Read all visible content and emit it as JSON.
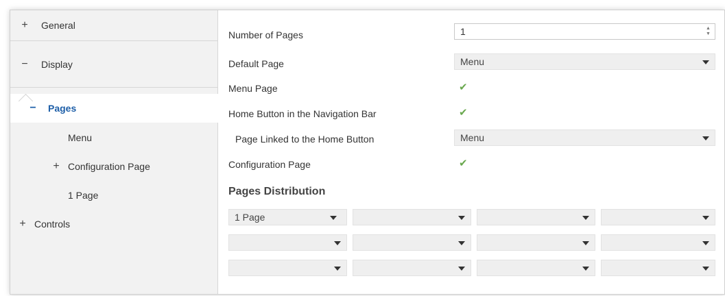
{
  "sidebar": {
    "items": [
      {
        "symbol": "+",
        "label": "General"
      },
      {
        "symbol": "−",
        "label": "Display"
      },
      {
        "symbol": "−",
        "label": "Pages"
      },
      {
        "symbol": "",
        "label": "Menu"
      },
      {
        "symbol": "+",
        "label": "Configuration Page"
      },
      {
        "symbol": "",
        "label": "1 Page"
      },
      {
        "symbol": "+",
        "label": "Controls"
      }
    ]
  },
  "main": {
    "number_of_pages": {
      "label": "Number of Pages",
      "value": "1"
    },
    "default_page": {
      "label": "Default Page",
      "value": "Menu"
    },
    "menu_page": {
      "label": "Menu Page",
      "checked": true
    },
    "home_button": {
      "label": "Home Button in the Navigation Bar",
      "checked": true
    },
    "page_linked": {
      "label": "Page Linked to the Home Button",
      "value": "Menu"
    },
    "configuration_page": {
      "label": "Configuration Page",
      "checked": true
    },
    "pages_distribution": {
      "title": "Pages Distribution",
      "slots": [
        "1 Page",
        "",
        "",
        "",
        "",
        "",
        "",
        "",
        "",
        "",
        "",
        ""
      ]
    }
  },
  "colors": {
    "accent": "#1e5fa8",
    "check": "#6aa84f",
    "sidebar_bg": "#f2f2f2",
    "dropdown_bg": "#efefef"
  }
}
